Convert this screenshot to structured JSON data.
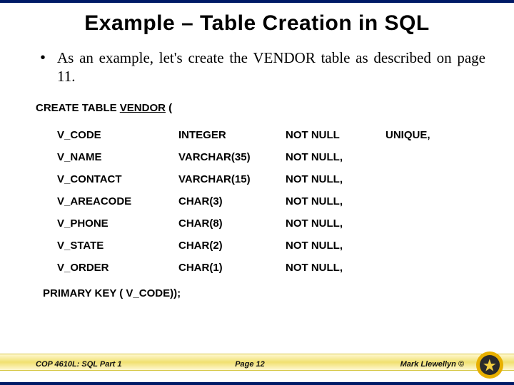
{
  "title": "Example – Table Creation in SQL",
  "bullet_glyph": "•",
  "body": "As an example, let's create the VENDOR table as described on page 11.",
  "create": {
    "prefix": "CREATE TABLE ",
    "table": "VENDOR",
    "suffix": " ("
  },
  "columns": [
    {
      "name": "V_CODE",
      "type": "INTEGER",
      "constraint": "NOT NULL",
      "extra": "UNIQUE,"
    },
    {
      "name": "V_NAME",
      "type": "VARCHAR(35)",
      "constraint": "NOT NULL,",
      "extra": ""
    },
    {
      "name": "V_CONTACT",
      "type": "VARCHAR(15)",
      "constraint": "NOT NULL,",
      "extra": ""
    },
    {
      "name": "V_AREACODE",
      "type": "CHAR(3)",
      "constraint": "NOT NULL,",
      "extra": ""
    },
    {
      "name": "V_PHONE",
      "type": "CHAR(8)",
      "constraint": "NOT NULL,",
      "extra": ""
    },
    {
      "name": "V_STATE",
      "type": "CHAR(2)",
      "constraint": "NOT NULL,",
      "extra": ""
    },
    {
      "name": "V_ORDER",
      "type": "CHAR(1)",
      "constraint": "NOT NULL,",
      "extra": ""
    }
  ],
  "primary_key_line": "PRIMARY KEY ( V_CODE));",
  "footer": {
    "left": "COP 4610L: SQL Part 1",
    "center": "Page 12",
    "right": "Mark Llewellyn ©"
  },
  "logo_colors": {
    "ring": "#e8b000",
    "inner": "#2b2b2b",
    "accent": "#f5d040"
  }
}
